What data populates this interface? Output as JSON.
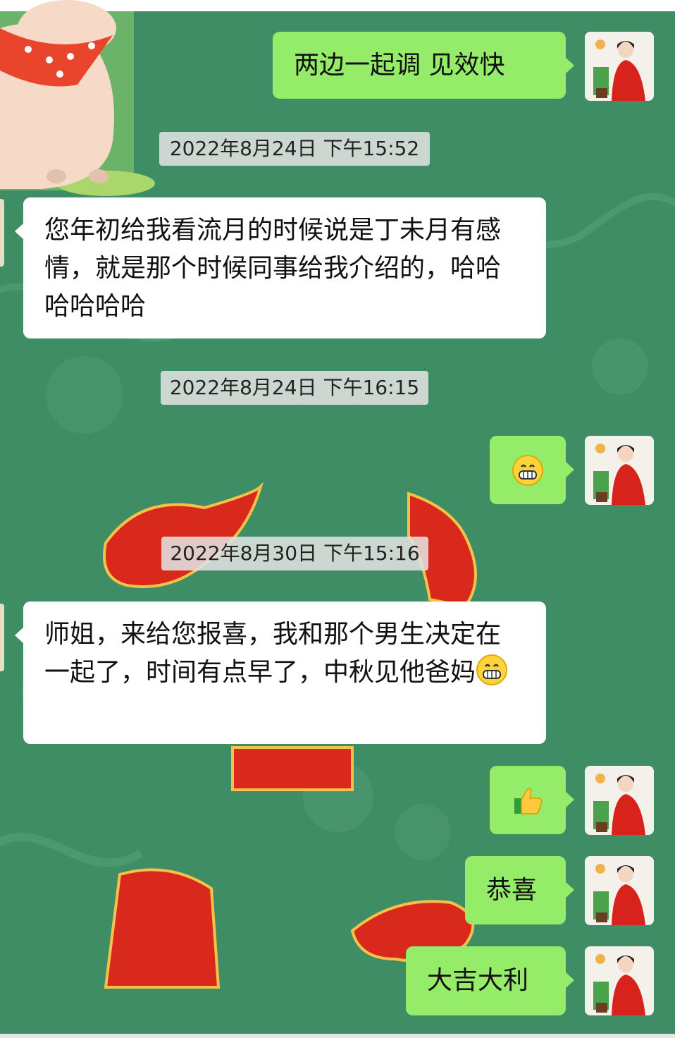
{
  "messages": [
    {
      "side": "right",
      "text": "两边一起调  见效快"
    },
    {
      "timestamp": "2022年8月24日  下午15:52"
    },
    {
      "side": "left",
      "text": "您年初给我看流月的时候说是丁未月有感情，就是那个时候同事给我介绍的，哈哈哈哈哈哈"
    },
    {
      "timestamp": "2022年8月24日  下午16:15"
    },
    {
      "side": "right",
      "emoji": "grinning-face-emoji"
    },
    {
      "timestamp": "2022年8月30日  下午15:16"
    },
    {
      "side": "left",
      "text": "师姐，来给您报喜，我和那个男生决定在一起了，时间有点早了，中秋见他爸妈",
      "trailing_emoji": "grinning-face-emoji"
    },
    {
      "side": "right",
      "emoji": "thumbs-up-emoji"
    },
    {
      "side": "right",
      "text": "恭喜"
    },
    {
      "side": "right",
      "text": "大吉大利"
    }
  ],
  "colors": {
    "chat_background": "#3f8d64",
    "sent_bubble": "#95ec69",
    "received_bubble": "#ffffff",
    "timestamp_chip": "#e1e1e1"
  }
}
